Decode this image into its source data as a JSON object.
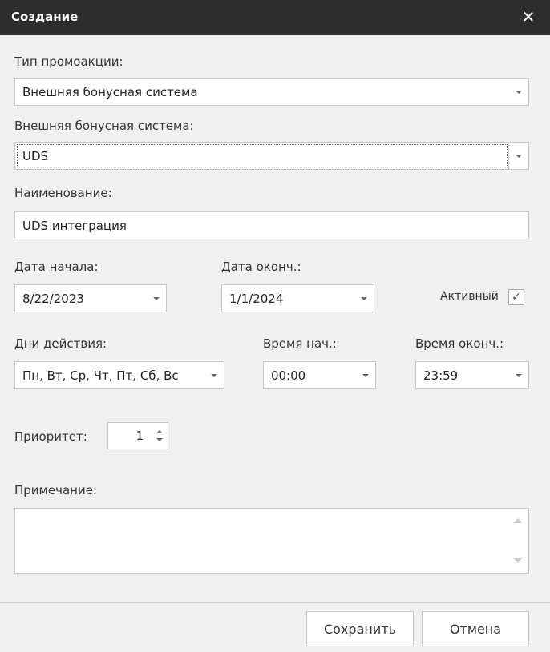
{
  "window": {
    "title": "Создание",
    "close_glyph": "✕"
  },
  "form": {
    "promo_type": {
      "label": "Тип промоакции:",
      "value": "Внешняя бонусная система"
    },
    "bonus_system": {
      "label": "Внешняя бонусная система:",
      "value": "UDS"
    },
    "name": {
      "label": "Наименование:",
      "value": "UDS интеграция"
    },
    "start_date": {
      "label": "Дата начала:",
      "value": "8/22/2023"
    },
    "end_date": {
      "label": "Дата оконч.:",
      "value": "1/1/2024"
    },
    "active": {
      "label": "Активный",
      "checked": true,
      "check_glyph": "✓"
    },
    "days": {
      "label": "Дни действия:",
      "value": "Пн, Вт, Ср, Чт, Пт, Сб, Вс"
    },
    "start_time": {
      "label": "Время нач.:",
      "value": "00:00"
    },
    "end_time": {
      "label": "Время оконч.:",
      "value": "23:59"
    },
    "priority": {
      "label": "Приоритет:",
      "value": "1"
    },
    "note": {
      "label": "Примечание:",
      "value": ""
    }
  },
  "footer": {
    "save_label": "Сохранить",
    "cancel_label": "Отмена"
  }
}
